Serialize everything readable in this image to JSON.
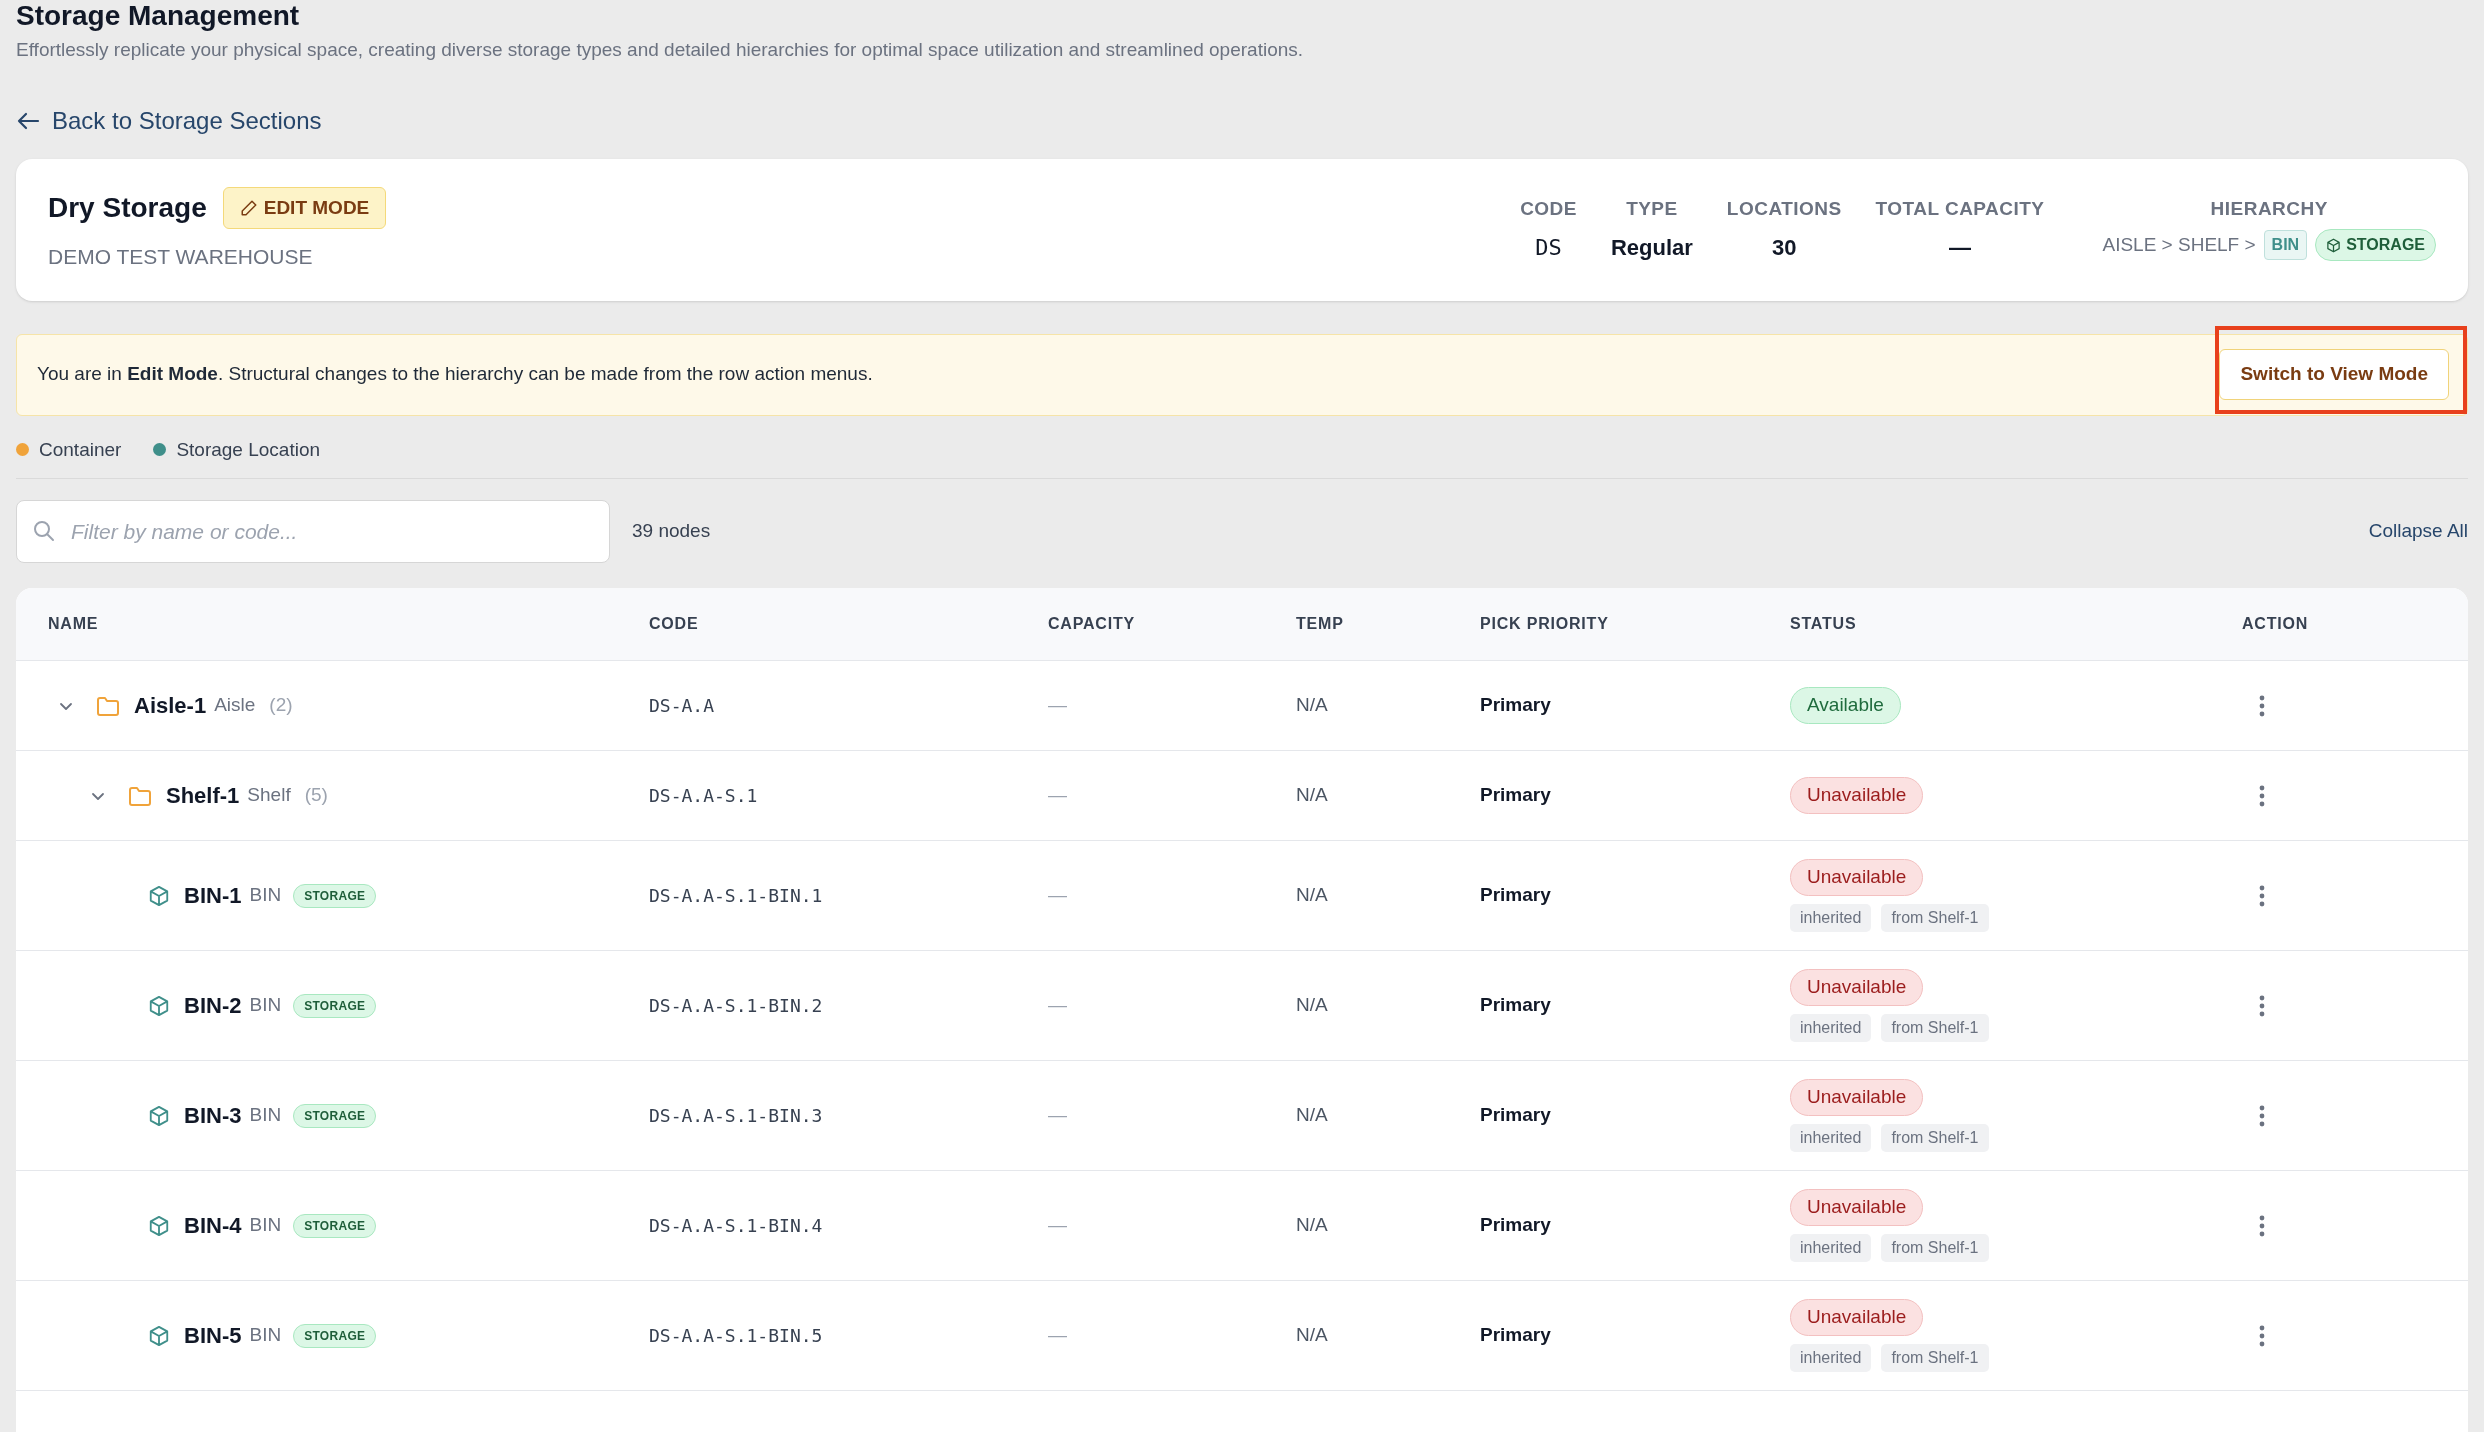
{
  "page": {
    "title": "Storage Management",
    "subtitle": "Effortlessly replicate your physical space, creating diverse storage types and detailed hierarchies for optimal space utilization and streamlined operations."
  },
  "back_link": {
    "label": "Back to Storage Sections"
  },
  "section": {
    "name": "Dry Storage",
    "mode_badge": "EDIT MODE",
    "warehouse": "DEMO TEST WAREHOUSE",
    "stats": [
      {
        "label": "CODE",
        "value": "DS",
        "kind": "mono"
      },
      {
        "label": "TYPE",
        "value": "Regular",
        "kind": "text"
      },
      {
        "label": "LOCATIONS",
        "value": "30",
        "kind": "text"
      },
      {
        "label": "TOTAL CAPACITY",
        "value": "—",
        "kind": "text"
      }
    ],
    "hierarchy": {
      "label": "HIERARCHY",
      "path": "AISLE > SHELF >",
      "last_level": "BIN",
      "storage_tag": "STORAGE"
    }
  },
  "banner": {
    "text": "You are in **Edit Mode**. Structural changes to the hierarchy can be made from the row action menus.",
    "button": "Switch to View Mode",
    "highlighted": true
  },
  "legend": [
    {
      "label": "Container",
      "color": "#f0a33a"
    },
    {
      "label": "Storage Location",
      "color": "#3f8f8a"
    }
  ],
  "filter": {
    "placeholder": "Filter by name or code...",
    "count": "39 nodes",
    "collapse_button": "Collapse All"
  },
  "table": {
    "columns": [
      "NAME",
      "CODE",
      "CAPACITY",
      "TEMP",
      "PICK PRIORITY",
      "STATUS",
      "ACTION"
    ],
    "rows": [
      {
        "kind": "container",
        "name": "Aisle-1",
        "type": "Aisle",
        "count": "(2)",
        "expanded": true,
        "code": "DS-A.A",
        "capacity": "—",
        "temp": "N/A",
        "priority": "Primary",
        "status": "Available",
        "available": true,
        "children": [
          {
            "kind": "container",
            "name": "Shelf-1",
            "type": "Shelf",
            "count": "(5)",
            "expanded": true,
            "code": "DS-A.A-S.1",
            "capacity": "—",
            "temp": "N/A",
            "priority": "Primary",
            "status": "Unavailable",
            "available": false,
            "children": [
              {
                "kind": "location",
                "name": "BIN-1",
                "type": "BIN",
                "tag": "STORAGE",
                "code": "DS-A.A-S.1-BIN.1",
                "capacity": "—",
                "temp": "N/A",
                "priority": "Primary",
                "status": "Unavailable",
                "available": false,
                "notes": [
                  "inherited",
                  "from Shelf-1"
                ]
              },
              {
                "kind": "location",
                "name": "BIN-2",
                "type": "BIN",
                "tag": "STORAGE",
                "code": "DS-A.A-S.1-BIN.2",
                "capacity": "—",
                "temp": "N/A",
                "priority": "Primary",
                "status": "Unavailable",
                "available": false,
                "notes": [
                  "inherited",
                  "from Shelf-1"
                ]
              },
              {
                "kind": "location",
                "name": "BIN-3",
                "type": "BIN",
                "tag": "STORAGE",
                "code": "DS-A.A-S.1-BIN.3",
                "capacity": "—",
                "temp": "N/A",
                "priority": "Primary",
                "status": "Unavailable",
                "available": false,
                "notes": [
                  "inherited",
                  "from Shelf-1"
                ]
              },
              {
                "kind": "location",
                "name": "BIN-4",
                "type": "BIN",
                "tag": "STORAGE",
                "code": "DS-A.A-S.1-BIN.4",
                "capacity": "—",
                "temp": "N/A",
                "priority": "Primary",
                "status": "Unavailable",
                "available": false,
                "notes": [
                  "inherited",
                  "from Shelf-1"
                ]
              },
              {
                "kind": "location",
                "name": "BIN-5",
                "type": "BIN",
                "tag": "STORAGE",
                "code": "DS-A.A-S.1-BIN.5",
                "capacity": "—",
                "temp": "N/A",
                "priority": "Primary",
                "status": "Unavailable",
                "available": false,
                "notes": [
                  "inherited",
                  "from Shelf-1"
                ]
              }
            ]
          }
        ]
      }
    ]
  }
}
